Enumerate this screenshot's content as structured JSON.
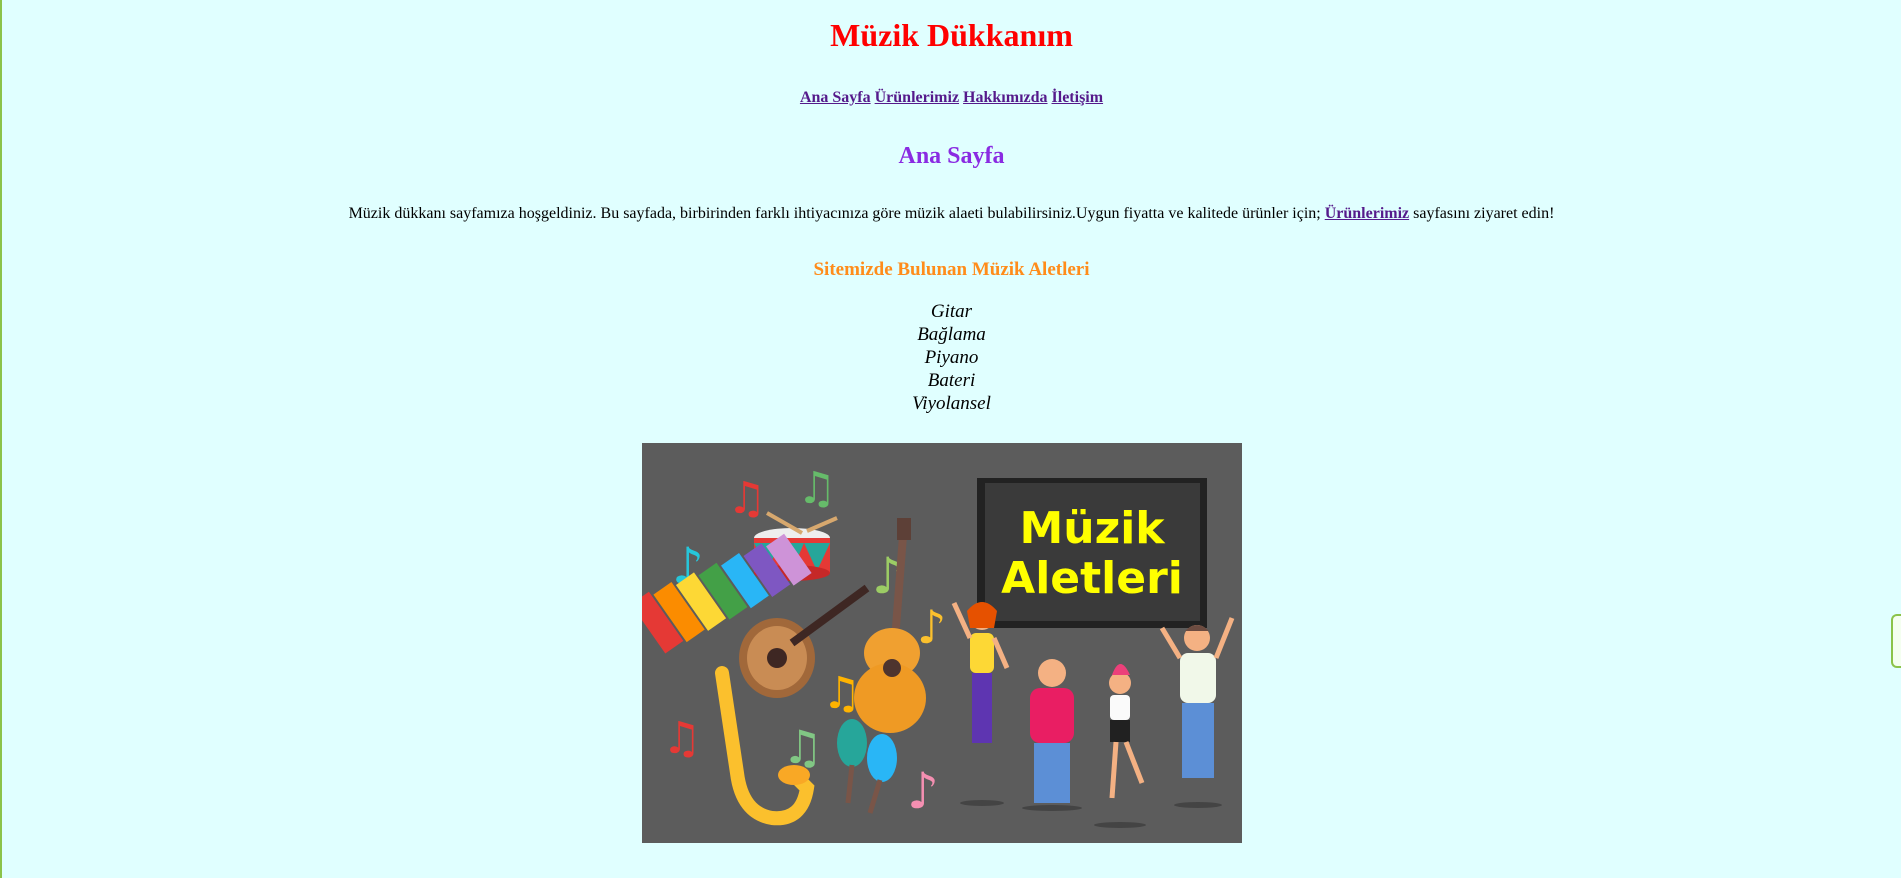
{
  "header": {
    "title": "Müzik Dükkanım"
  },
  "nav": {
    "items": [
      {
        "label": "Ana Sayfa"
      },
      {
        "label": "Ürünlerimiz"
      },
      {
        "label": "Hakkımızda"
      },
      {
        "label": "İletişim"
      }
    ]
  },
  "main": {
    "section_title": "Ana Sayfa",
    "intro_text": "Müzik dükkanı sayfamıza hoşgeldiniz. Bu sayfada, birbirinden farklı ihtiyacınıza göre müzik alaeti bulabilirsiniz.Uygun fiyatta ve kalitede ürünler için;",
    "intro_link": "Ürünlerimiz",
    "intro_suffix": "sayfasını ziyaret edin!",
    "list_title": "Sitemizde Bulunan Müzik Aletleri",
    "instruments": [
      "Gitar",
      "Bağlama",
      "Piyano",
      "Bateri",
      "Viyolansel"
    ]
  },
  "banner": {
    "board_text_line1": "Müzik",
    "board_text_line2": "Aletleri"
  },
  "colors": {
    "background": "#e0ffff",
    "title": "#ff0000",
    "section_title": "#8a2be2",
    "list_title": "#ff8c1a",
    "link": "#551a8b",
    "banner_bg": "#5c5c5c",
    "board_text": "#ffff00"
  }
}
